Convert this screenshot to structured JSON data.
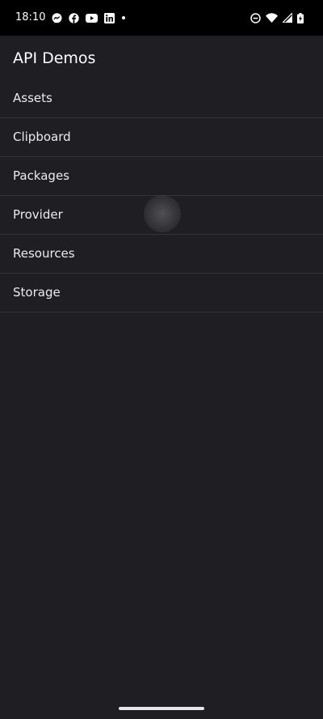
{
  "status_bar": {
    "time": "18:10",
    "notification_icons": [
      "messenger-icon",
      "facebook-icon",
      "youtube-icon",
      "linkedin-icon",
      "more-dot-icon"
    ],
    "system_icons": [
      "do-not-disturb-icon",
      "wifi-icon",
      "cell-signal-icon",
      "battery-charging-icon"
    ]
  },
  "app_bar": {
    "title": "API Demos"
  },
  "list": {
    "items": [
      {
        "label": "Assets"
      },
      {
        "label": "Clipboard"
      },
      {
        "label": "Packages"
      },
      {
        "label": "Provider"
      },
      {
        "label": "Resources"
      },
      {
        "label": "Storage"
      }
    ]
  },
  "colors": {
    "background": "#1f1e23",
    "status_bar": "#000000",
    "text": "#ecebf0",
    "divider": "#34333a"
  }
}
